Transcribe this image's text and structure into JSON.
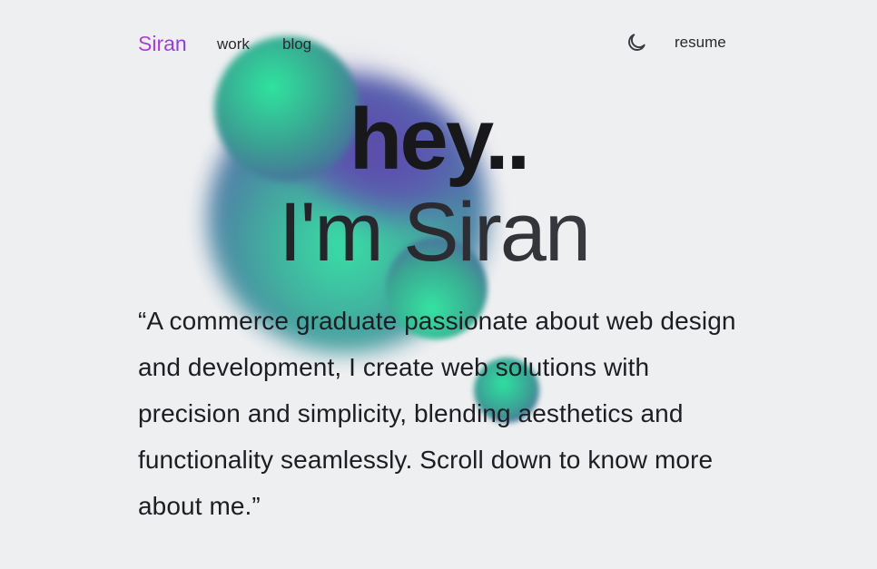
{
  "nav": {
    "logo": "Siran",
    "links": [
      {
        "label": "work"
      },
      {
        "label": "blog"
      }
    ],
    "theme_icon": "moon-icon",
    "resume_label": "resume"
  },
  "hero": {
    "line1": "hey..",
    "line2": "I'm Siran"
  },
  "bio": {
    "text": "“A commerce graduate passionate about web design and development, I create web solutions with precision and simplicity, blending aesthetics and functionality seamlessly. Scroll down to know more about me.”"
  },
  "colors": {
    "background": "#eeeff1",
    "logo": "#a63bd9",
    "blob_green": "#2fe0a2",
    "blob_purple": "#5a4aa8",
    "text": "#1d1d22"
  }
}
